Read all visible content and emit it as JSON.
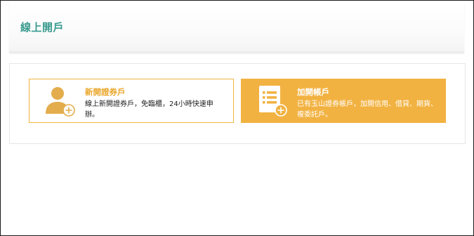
{
  "page": {
    "title": "線上開戶"
  },
  "cards": [
    {
      "title": "新開證券戶",
      "description": "線上新開證券戶，免臨櫃，24小時快速申辦。",
      "icon": "person-add-icon",
      "accent_color": "#f0b440",
      "background": "#ffffff"
    },
    {
      "title": "加開帳戶",
      "description": "已有玉山證券帳戶，加開信用、借貸、期貨、複委託戶。",
      "icon": "document-list-add-icon",
      "accent_color": "#ffffff",
      "background": "#f2b241"
    }
  ],
  "colors": {
    "title_teal": "#3a9b8f",
    "card_gold": "#f2b241"
  }
}
